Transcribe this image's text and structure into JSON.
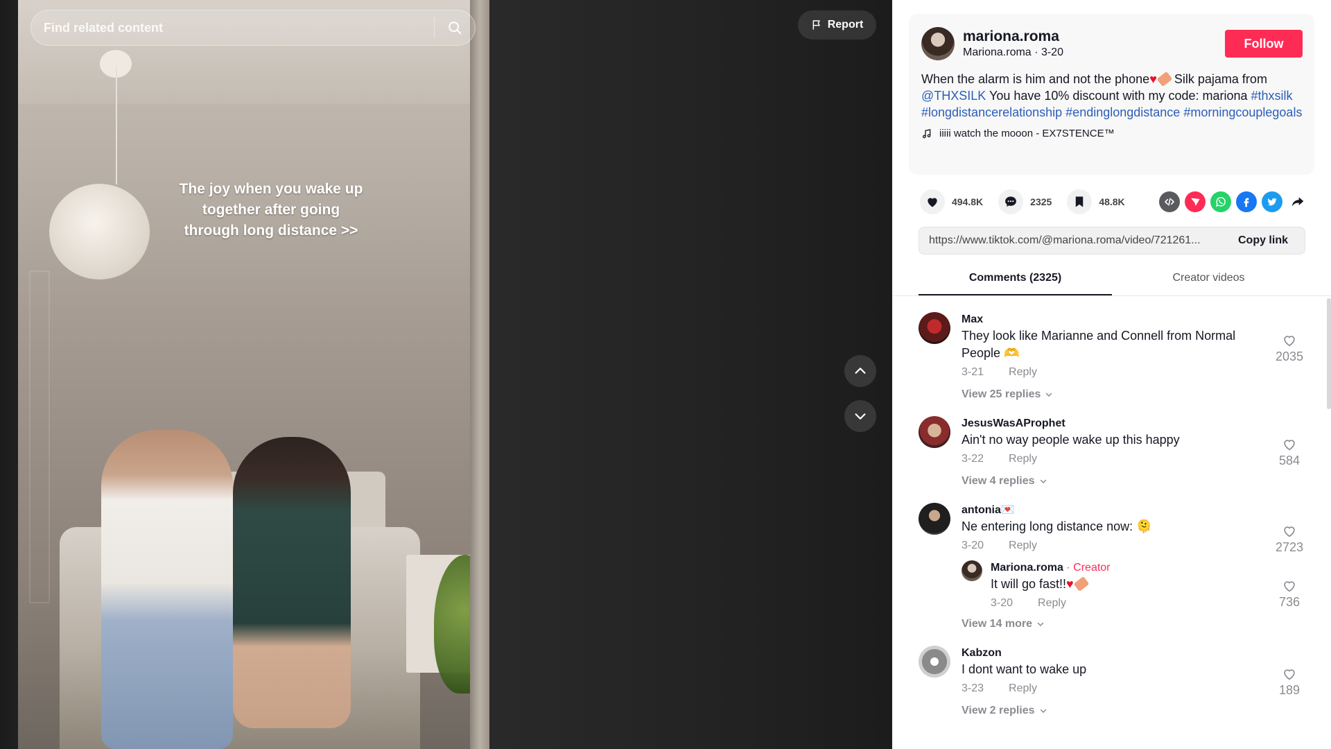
{
  "search": {
    "placeholder": "Find related content"
  },
  "report": {
    "label": "Report"
  },
  "video": {
    "caption_lines": [
      "The joy when you wake up",
      "together after going",
      "through long distance >>"
    ]
  },
  "author": {
    "username": "mariona.roma",
    "nickname": "Mariona.roma",
    "date": "3-20",
    "follow_label": "Follow"
  },
  "description": {
    "text_1": "When the alarm is him and not the phone",
    "text_2": " Silk pajama from ",
    "mention": "@THXSILK",
    "text_3": " You have 10% discount with my code: mariona ",
    "hashtags": [
      "#thxsilk",
      "#longdistancerelationship",
      "#endinglongdistance",
      "#morningcouplegoals"
    ],
    "music": "iiiii watch the mooon - EX7STENCE™"
  },
  "stats": {
    "likes": "494.8K",
    "comments": "2325",
    "saves": "48.8K"
  },
  "share_icons": [
    "embed-icon",
    "send-icon",
    "whatsapp-icon",
    "facebook-icon",
    "twitter-icon",
    "share-arrow-icon"
  ],
  "colors": {
    "accent": "#fe2c55",
    "link": "#2b5db9",
    "whatsapp": "#25d366",
    "facebook": "#1877f2",
    "twitter": "#1d9bf0"
  },
  "link_box": {
    "url": "https://www.tiktok.com/@mariona.roma/video/721261...",
    "copy_label": "Copy link"
  },
  "tabs": {
    "comments": "Comments (2325)",
    "creator_videos": "Creator videos"
  },
  "comments": [
    {
      "user": "Max",
      "text": "They look like Marianne and Connell from Normal People 🫶",
      "date": "3-21",
      "reply": "Reply",
      "likes": "2035",
      "view_replies": "View 25 replies"
    },
    {
      "user": "JesusWasAProphet",
      "text": "Ain't no way people wake up this happy",
      "date": "3-22",
      "reply": "Reply",
      "likes": "584",
      "view_replies": "View 4 replies"
    },
    {
      "user": "antonia💌",
      "text": "Ne entering long distance now: 🫠",
      "date": "3-20",
      "reply": "Reply",
      "likes": "2723",
      "sub_reply": {
        "user": "Mariona.roma",
        "creator_tag": "Creator",
        "text": "It will go fast!!",
        "date": "3-20",
        "reply": "Reply",
        "likes": "736"
      },
      "view_replies": "View 14 more"
    },
    {
      "user": "Kabzon",
      "text": "I dont want to wake up",
      "date": "3-23",
      "reply": "Reply",
      "likes": "189",
      "view_replies": "View 2 replies"
    }
  ]
}
